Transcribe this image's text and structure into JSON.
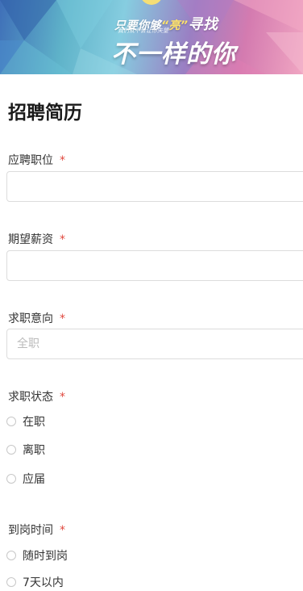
{
  "banner": {
    "line1_part1": "只要你够",
    "line1_highlight": "“亮”",
    "line1_part2": "寻找",
    "line2": "我们就不会让你失望",
    "line3": "不一样的你"
  },
  "form": {
    "title": "招聘简历",
    "required_mark": "*",
    "fields": [
      {
        "label": "应聘职位",
        "value": ""
      },
      {
        "label": "期望薪资",
        "value": ""
      },
      {
        "label": "求职意向",
        "placeholder": "全职"
      }
    ],
    "status": {
      "label": "求职状态",
      "options": [
        "在职",
        "离职",
        "应届"
      ]
    },
    "arrival": {
      "label": "到岗时间",
      "options": [
        "随时到岗",
        "7天以内"
      ]
    }
  }
}
